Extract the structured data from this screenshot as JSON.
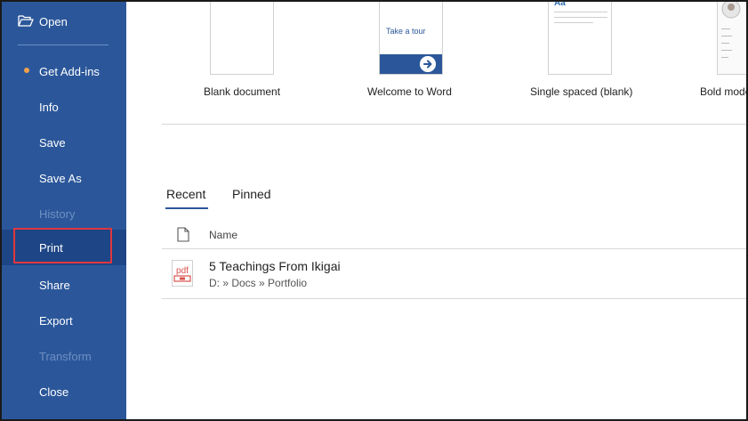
{
  "sidebar": {
    "items": [
      {
        "label": "Open",
        "icon": "folder-open-icon"
      },
      {
        "label": "Get Add-ins"
      },
      {
        "label": "Info"
      },
      {
        "label": "Save"
      },
      {
        "label": "Save As"
      },
      {
        "label": "History",
        "disabled": true
      },
      {
        "label": "Print",
        "selected": true
      },
      {
        "label": "Share"
      },
      {
        "label": "Export"
      },
      {
        "label": "Transform",
        "disabled": true
      },
      {
        "label": "Close"
      }
    ],
    "colors": {
      "background": "#2b579a",
      "selected": "#1e4585",
      "dot": "#f0a04b",
      "highlight_border": "#e0373f"
    }
  },
  "templates": [
    {
      "label": "Blank document"
    },
    {
      "label": "Welcome to Word",
      "thumb_text": "Take a tour"
    },
    {
      "label": "Single spaced (blank)",
      "thumb_text": "Aa"
    },
    {
      "label": "Bold modern resume"
    }
  ],
  "tabs": [
    {
      "label": "Recent",
      "active": true
    },
    {
      "label": "Pinned"
    }
  ],
  "list": {
    "column_name": "Name",
    "files": [
      {
        "title": "5 Teachings From Ikigai",
        "path": "D: » Docs » Portfolio",
        "type": "pdf"
      }
    ]
  }
}
